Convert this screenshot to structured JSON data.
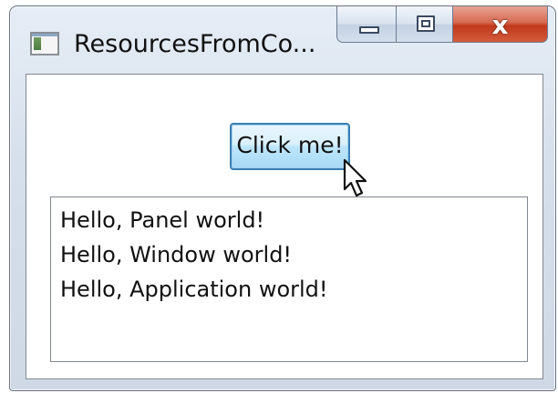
{
  "window": {
    "title": "ResourcesFromCo...",
    "app_icon": "window-app-icon"
  },
  "caption_buttons": {
    "minimize_icon": "minimize-icon",
    "maximize_icon": "maximize-icon",
    "close_icon": "close-icon",
    "close_glyph": "x"
  },
  "content": {
    "button_label": "Click me!",
    "cursor_icon": "mouse-pointer-icon",
    "list_items": [
      "Hello, Panel world!",
      "Hello, Window world!",
      "Hello, Application world!"
    ]
  },
  "colors": {
    "close_button": "#c1391c",
    "button_focus_border": "#3c7fb1"
  }
}
